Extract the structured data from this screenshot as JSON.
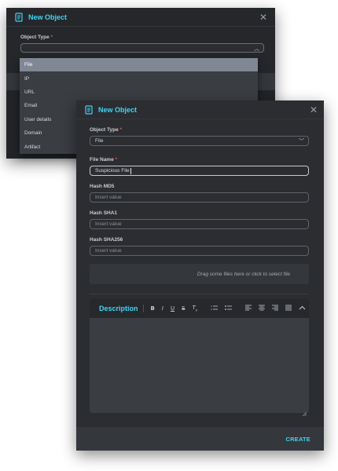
{
  "back_dialog": {
    "title": "New Object",
    "object_type_label": "Object Type",
    "required_mark": "*",
    "dropdown_options": [
      "File",
      "IP",
      "URL",
      "Email",
      "User details",
      "Domain",
      "Artifact"
    ],
    "selected_option": "File"
  },
  "front_dialog": {
    "title": "New Object",
    "object_type": {
      "label": "Object Type",
      "required_mark": "*",
      "value": "File"
    },
    "file_name": {
      "label": "File Name",
      "required_mark": "*",
      "value": "Suspicious File"
    },
    "hash_md5": {
      "label": "Hash MD5",
      "placeholder": "Insert value"
    },
    "hash_sha1": {
      "label": "Hash SHA1",
      "placeholder": "Insert value"
    },
    "hash_sha256": {
      "label": "Hash SHA256",
      "placeholder": "Insert value"
    },
    "dropzone_text": "Drag some files here or click to select file",
    "editor": {
      "label": "Description",
      "tools": [
        "B",
        "I",
        "U",
        "S",
        "Tx",
        "ordered-list",
        "bullet-list",
        "align-left",
        "align-center",
        "align-right",
        "justify",
        "collapse"
      ]
    },
    "create_label": "CREATE"
  },
  "colors": {
    "accent": "#3dd6f5",
    "required": "#f04e4e",
    "dialog_bg": "#2b2d31",
    "selected_option_bg": "#7f8894"
  }
}
